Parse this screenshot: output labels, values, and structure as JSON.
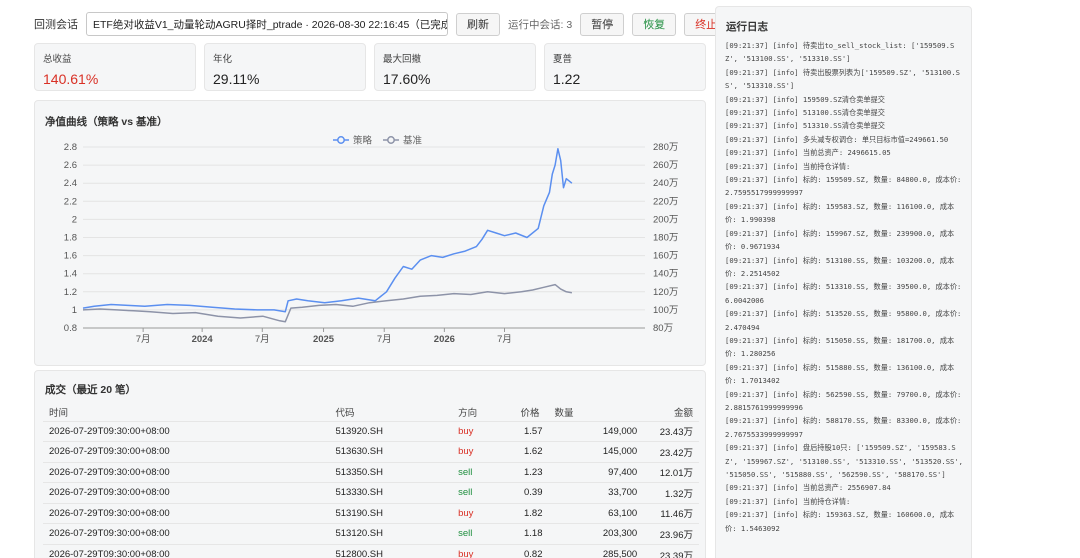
{
  "toolbar": {
    "session_label": "回测会话",
    "session_value": "ETF绝对收益V1_动量轮动AGRU择时_ptrade · 2026-08-30 22:16:45（已完成）",
    "refresh": "刷新",
    "running": "运行中会话: 3",
    "pause": "暂停",
    "resume": "恢复",
    "stop": "终止"
  },
  "metrics": [
    {
      "label": "总收益",
      "value": "140.61%"
    },
    {
      "label": "年化",
      "value": "29.11%"
    },
    {
      "label": "最大回撤",
      "value": "17.60%"
    },
    {
      "label": "夏普",
      "value": "1.22"
    }
  ],
  "chart_title": "净值曲线（策略 vs 基准）",
  "chart_data": {
    "type": "line",
    "x_ticks": [
      "7月",
      "2024",
      "7月",
      "2025",
      "7月",
      "2026",
      "7月"
    ],
    "x_tick_pos": [
      0.107,
      0.212,
      0.319,
      0.428,
      0.536,
      0.643,
      0.75
    ],
    "ylim": [
      0.8,
      2.8
    ],
    "yticks": [
      0.8,
      1,
      1.2,
      1.4,
      1.6,
      1.8,
      2,
      2.2,
      2.4,
      2.6,
      2.8
    ],
    "y2lim": [
      800000,
      2800000
    ],
    "y2ticks": [
      "80万",
      "100万",
      "120万",
      "140万",
      "160万",
      "180万",
      "200万",
      "220万",
      "240万",
      "260万",
      "280万"
    ],
    "legend_position": "top-center",
    "grid": "horizontal",
    "series": [
      {
        "name": "策略",
        "color": "#5b8ff0",
        "x": [
          0,
          0.02,
          0.05,
          0.08,
          0.11,
          0.15,
          0.19,
          0.23,
          0.27,
          0.31,
          0.34,
          0.36,
          0.365,
          0.38,
          0.4,
          0.43,
          0.46,
          0.49,
          0.52,
          0.54,
          0.555,
          0.57,
          0.585,
          0.6,
          0.62,
          0.64,
          0.66,
          0.68,
          0.7,
          0.71,
          0.72,
          0.735,
          0.75,
          0.77,
          0.79,
          0.81,
          0.82,
          0.83,
          0.835,
          0.84,
          0.845,
          0.85,
          0.855,
          0.86,
          0.87
        ],
        "values": [
          1.02,
          1.04,
          1.06,
          1.05,
          1.04,
          1.06,
          1.05,
          1.03,
          1.01,
          1.0,
          1.0,
          0.98,
          1.1,
          1.12,
          1.1,
          1.08,
          1.1,
          1.13,
          1.1,
          1.2,
          1.35,
          1.48,
          1.45,
          1.55,
          1.6,
          1.58,
          1.62,
          1.65,
          1.7,
          1.78,
          1.88,
          1.85,
          1.82,
          1.85,
          1.8,
          1.9,
          2.15,
          2.3,
          2.5,
          2.6,
          2.78,
          2.65,
          2.35,
          2.45,
          2.4
        ]
      },
      {
        "name": "基准",
        "color": "#8d93a8",
        "x": [
          0,
          0.03,
          0.06,
          0.09,
          0.12,
          0.16,
          0.2,
          0.24,
          0.28,
          0.32,
          0.35,
          0.36,
          0.37,
          0.39,
          0.42,
          0.45,
          0.48,
          0.51,
          0.54,
          0.57,
          0.6,
          0.63,
          0.66,
          0.69,
          0.72,
          0.75,
          0.78,
          0.8,
          0.82,
          0.84,
          0.85,
          0.86,
          0.87
        ],
        "values": [
          1.0,
          1.01,
          1.0,
          0.99,
          0.98,
          0.96,
          0.97,
          0.93,
          0.91,
          0.93,
          0.88,
          0.87,
          1.02,
          1.03,
          1.05,
          1.06,
          1.04,
          1.08,
          1.1,
          1.12,
          1.15,
          1.16,
          1.18,
          1.17,
          1.2,
          1.18,
          1.2,
          1.22,
          1.25,
          1.28,
          1.23,
          1.2,
          1.19
        ]
      }
    ]
  },
  "trades_title": "成交（最近 20 笔）",
  "trades_columns": [
    "时间",
    "代码",
    "方向",
    "价格",
    "数量",
    "金额"
  ],
  "trades": [
    [
      "2026-07-29T09:30:00+08:00",
      "513920.SH",
      "buy",
      "1.57",
      "149,000",
      "23.43万"
    ],
    [
      "2026-07-29T09:30:00+08:00",
      "513630.SH",
      "buy",
      "1.62",
      "145,000",
      "23.42万"
    ],
    [
      "2026-07-29T09:30:00+08:00",
      "513350.SH",
      "sell",
      "1.23",
      "97,400",
      "12.01万"
    ],
    [
      "2026-07-29T09:30:00+08:00",
      "513330.SH",
      "sell",
      "0.39",
      "33,700",
      "1.32万"
    ],
    [
      "2026-07-29T09:30:00+08:00",
      "513190.SH",
      "buy",
      "1.82",
      "63,100",
      "11.46万"
    ],
    [
      "2026-07-29T09:30:00+08:00",
      "513120.SH",
      "sell",
      "1.18",
      "203,300",
      "23.96万"
    ],
    [
      "2026-07-29T09:30:00+08:00",
      "512800.SH",
      "buy",
      "0.82",
      "285,500",
      "23.39万"
    ]
  ],
  "log_title": "运行日志",
  "log_lines": [
    "[09:21:37] [info] 待卖出to_sell_stock_list: ['159509.SZ', '513100.SS', '513310.SS']",
    "[09:21:37] [info] 待卖出股票列表为['159509.SZ', '513100.SS', '513310.SS']",
    "[09:21:37] [info] 159509.SZ清仓卖单提交",
    "[09:21:37] [info] 513100.SS清仓卖单提交",
    "[09:21:37] [info] 513310.SS清仓卖单提交",
    "[09:21:37] [info] 多头减专权调仓: 单只目标市值=249661.50",
    "[09:21:37] [info] 当前总资产: 2496615.05",
    "[09:21:37] [info] 当前持仓详情:",
    "[09:21:37] [info] 标的: 159509.SZ, 数量: 84800.0, 成本价: 2.7595517999999997",
    "[09:21:37] [info] 标的: 159583.SZ, 数量: 116100.0, 成本价: 1.990398",
    "[09:21:37] [info] 标的: 159967.SZ, 数量: 239900.0, 成本价: 0.9671934",
    "[09:21:37] [info] 标的: 513100.SS, 数量: 103200.0, 成本价: 2.2514502",
    "[09:21:37] [info] 标的: 513310.SS, 数量: 39500.0, 成本价: 6.0042006",
    "[09:21:37] [info] 标的: 513520.SS, 数量: 95800.0, 成本价: 2.470494",
    "[09:21:37] [info] 标的: 515050.SS, 数量: 181700.0, 成本价: 1.280256",
    "[09:21:37] [info] 标的: 515880.SS, 数量: 136100.0, 成本价: 1.7013402",
    "[09:21:37] [info] 标的: 562590.SS, 数量: 79700.0, 成本价: 2.8815761999999996",
    "[09:21:37] [info] 标的: 588170.SS, 数量: 83300.0, 成本价: 2.7675533999999997",
    "[09:21:37] [info] 盘后持股10只: ['159509.SZ', '159583.SZ', '159967.SZ', '513100.SS', '513310.SS', '513520.SS', '515050.SS', '515880.SS', '562590.SS', '588170.SS']",
    "[09:21:37] [info] 当前总资产: 2556907.84",
    "[09:21:37] [info] 当前持仓详情:",
    "[09:21:37] [info] 标的: 159363.SZ, 数量: 160600.0, 成本价: 1.5463092"
  ]
}
